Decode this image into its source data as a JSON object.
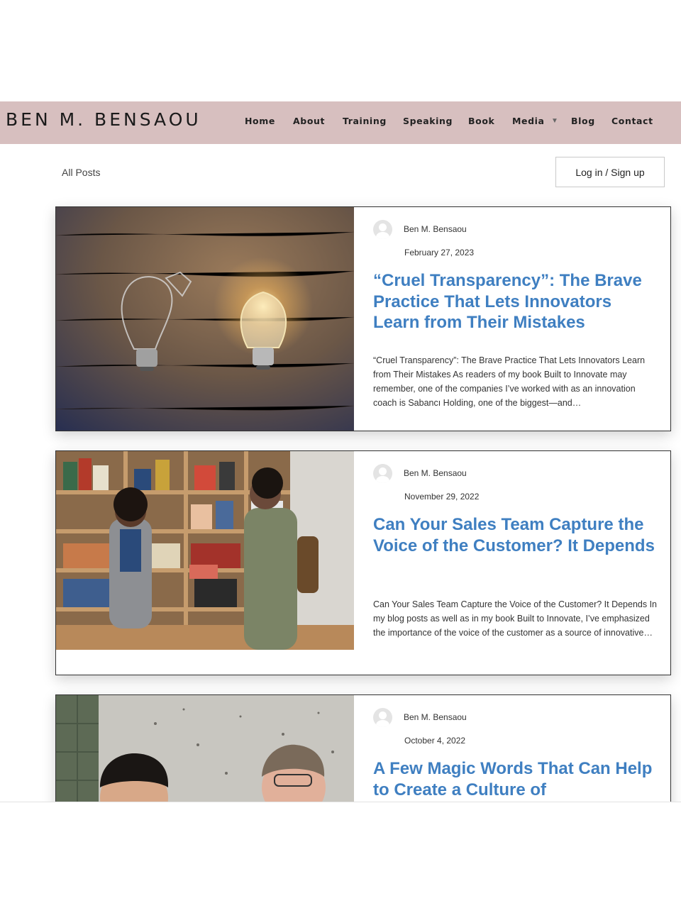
{
  "header": {
    "site_title": "BEN M. BENSAOU",
    "nav": [
      "Home",
      "About",
      "Training",
      "Speaking",
      "Book",
      "Media",
      "Blog",
      "Contact"
    ],
    "background": "#d7bfbf"
  },
  "toolbar": {
    "all_posts": "All Posts",
    "login": "Log in / Sign up"
  },
  "posts": [
    {
      "author": "Ben M. Bensaou",
      "date": "February 27, 2023",
      "title": "“Cruel Transparency”: The Brave Practice That Lets Innovators Learn from Their Mistakes",
      "excerpt": "“Cruel Transparency”: The Brave Practice That Lets Innovators Learn from Their Mistakes As readers of my book Built to Innovate may remember, one of the companies I’ve worked with as an innovation coach is Sabancı Holding, one of the biggest—and…",
      "image": "two-light-bulbs-on-wood"
    },
    {
      "author": "Ben M. Bensaou",
      "date": "November 29, 2022",
      "title": "Can Your Sales Team Capture the Voice of the Customer? It Depends",
      "excerpt": "Can Your Sales Team Capture the Voice of the Customer? It Depends In my blog posts as well as in my book Built to Innovate, I’ve emphasized the importance of the voice of the customer as a source of innovative…",
      "image": "bookstore-customer-and-clerk"
    },
    {
      "author": "Ben M. Bensaou",
      "date": "October 4, 2022",
      "title": "A Few Magic Words That Can Help to Create a Culture of",
      "excerpt": "",
      "image": "two-men-smiling"
    }
  ],
  "colors": {
    "title_link": "#3f7fc1",
    "header_bg": "#d7bfbf"
  }
}
